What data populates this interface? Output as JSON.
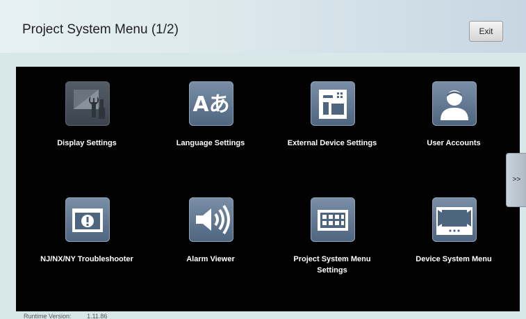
{
  "header": {
    "title": "Project System Menu (1/2)",
    "exit_label": "Exit"
  },
  "tiles": [
    {
      "label": "Display Settings",
      "icon": "display-settings-icon"
    },
    {
      "label": "Language Settings",
      "icon": "language-icon"
    },
    {
      "label": "External Device Settings",
      "icon": "external-device-icon"
    },
    {
      "label": "User Accounts",
      "icon": "user-icon"
    },
    {
      "label": "NJ/NX/NY Troubleshooter",
      "icon": "troubleshooter-icon"
    },
    {
      "label": "Alarm Viewer",
      "icon": "speaker-icon"
    },
    {
      "label": "Project System Menu Settings",
      "icon": "keypad-icon"
    },
    {
      "label": "Device System Menu",
      "icon": "device-screen-icon"
    }
  ],
  "language_glyph": "Aあ",
  "next_page_label": ">>",
  "footer": {
    "runtime_label": "Runtime Version:",
    "runtime_value": "1.11.86"
  }
}
